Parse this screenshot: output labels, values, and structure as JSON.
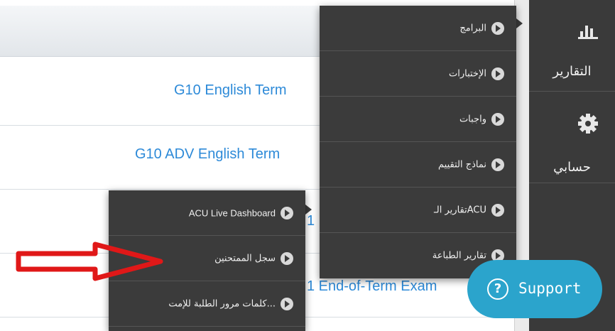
{
  "list": {
    "rows": [
      {
        "label": "G10 English Term"
      },
      {
        "label": "G10 ADV English Term"
      },
      {
        "label": "1"
      },
      {
        "label": "1"
      },
      {
        "label": "1 End-of-Term Exam"
      }
    ]
  },
  "sidebar": {
    "items": [
      {
        "label": "التقارير",
        "icon": "bar-chart-icon"
      },
      {
        "label": "حسابي",
        "icon": "gear-icon"
      }
    ]
  },
  "main_menu": {
    "items": [
      {
        "label": "البرامج",
        "icon": "list-bullet-icon",
        "has_submenu": true
      },
      {
        "label": "الإختبارات",
        "icon": "list-bullet-icon"
      },
      {
        "label": "واجبات",
        "icon": "list-bullet-icon"
      },
      {
        "label": "نماذج التقييم",
        "icon": "list-bullet-icon"
      },
      {
        "label": "تقارير الـACU",
        "icon": "list-bullet-icon",
        "has_submenu": true
      },
      {
        "label": "تقارير الطباعة",
        "icon": "list-bullet-icon"
      }
    ]
  },
  "sub_menu": {
    "items": [
      {
        "label": "ACU Live Dashboard",
        "icon": "list-bullet-icon"
      },
      {
        "label": "سجل الممتحنين",
        "icon": "list-bullet-icon"
      },
      {
        "label": "كلمات مرور الطلبة للإمت...",
        "icon": "list-bullet-icon"
      }
    ]
  },
  "support": {
    "label": "Support",
    "icon": "question-circle-icon"
  },
  "colors": {
    "menu_bg": "#3b3b3b",
    "link": "#2d8ad8",
    "support_bg": "#2ba4cc",
    "annotation": "#e01818"
  }
}
